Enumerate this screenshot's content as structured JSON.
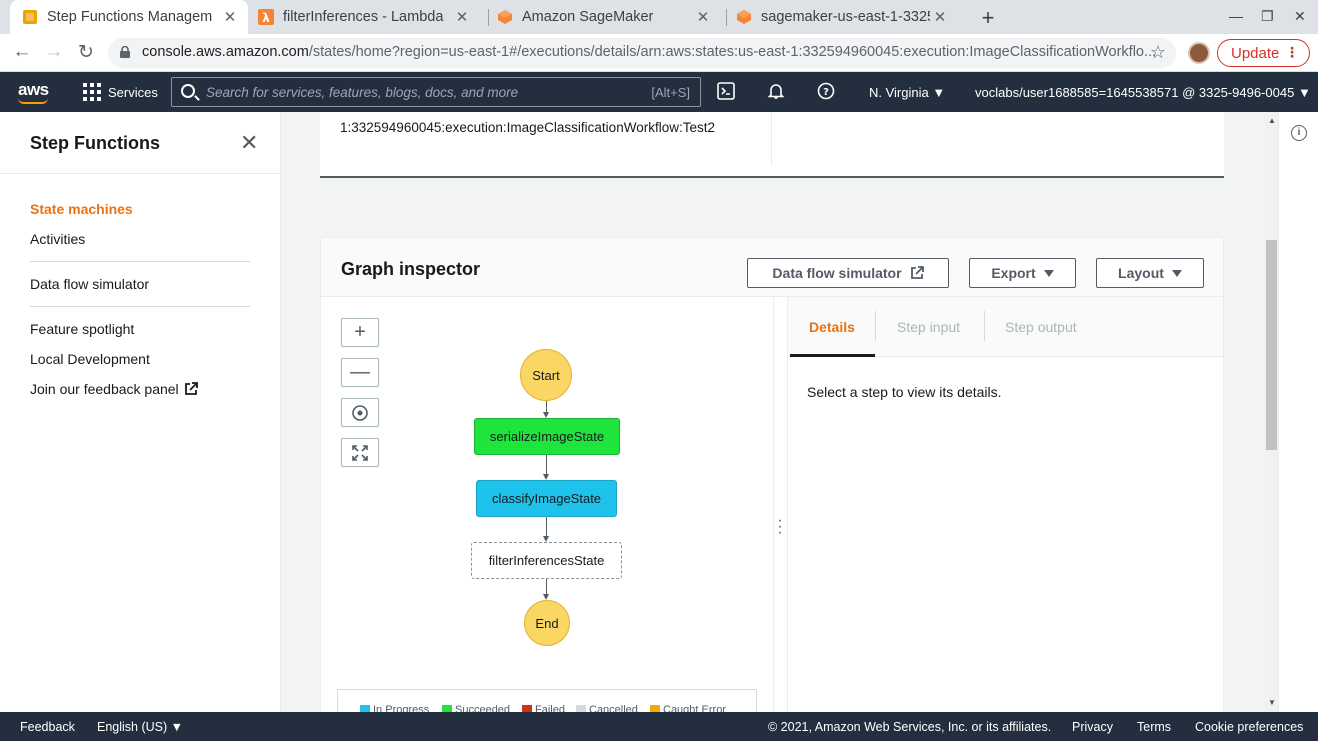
{
  "browser": {
    "tabs": [
      {
        "title": "Step Functions Managem",
        "icon": "step-functions-icon"
      },
      {
        "title": "filterInferences - Lambda",
        "icon": "lambda-icon"
      },
      {
        "title": "Amazon SageMaker",
        "icon": "sagemaker-icon"
      },
      {
        "title": "sagemaker-us-east-1-3325",
        "icon": "s3-icon"
      }
    ],
    "url_host": "console.aws.amazon.com",
    "url_path": "/states/home?region=us-east-1#/executions/details/arn:aws:states:us-east-1:332594960045:execution:ImageClassificationWorkflo...",
    "update_label": "Update"
  },
  "aws_nav": {
    "logo": "aws",
    "services_label": "Services",
    "search_placeholder": "Search for services, features, blogs, docs, and more",
    "search_shortcut": "[Alt+S]",
    "region": "N. Virginia",
    "account": "voclabs/user1688585=1645538571 @ 3325-9496-0045"
  },
  "sidebar": {
    "title": "Step Functions",
    "items": [
      {
        "label": "State machines",
        "active": true
      },
      {
        "label": "Activities"
      },
      {
        "label": "Data flow simulator"
      },
      {
        "label": "Feature spotlight"
      },
      {
        "label": "Local Development"
      },
      {
        "label": "Join our feedback panel"
      }
    ]
  },
  "execution": {
    "arn_tail": "1:332594960045:execution:ImageClassificationWorkflow:Test2"
  },
  "graph_inspector": {
    "title": "Graph inspector",
    "buttons": {
      "simulator": "Data flow simulator",
      "export": "Export",
      "layout": "Layout"
    },
    "nodes": {
      "start": "Start",
      "serialize": "serializeImageState",
      "classify": "classifyImageState",
      "filter": "filterInferencesState",
      "end": "End"
    },
    "node_colors": {
      "succeeded": "#1ee43c",
      "in_progress": "#1ec3ec",
      "terminal": "#fad664"
    },
    "tabs": [
      "Details",
      "Step input",
      "Step output"
    ],
    "select_message": "Select a step to view its details.",
    "legend": [
      {
        "label": "In Progress",
        "color": "#1ec3ec"
      },
      {
        "label": "Succeeded",
        "color": "#1ee43c"
      },
      {
        "label": "Failed",
        "color": "#d13212"
      },
      {
        "label": "Cancelled",
        "color": "#d5dbdb"
      },
      {
        "label": "Caught Error",
        "color": "#f2a900"
      }
    ]
  },
  "footer": {
    "feedback": "Feedback",
    "language": "English (US)",
    "copyright": "© 2021, Amazon Web Services, Inc. or its affiliates.",
    "privacy": "Privacy",
    "terms": "Terms",
    "cookies": "Cookie preferences"
  }
}
